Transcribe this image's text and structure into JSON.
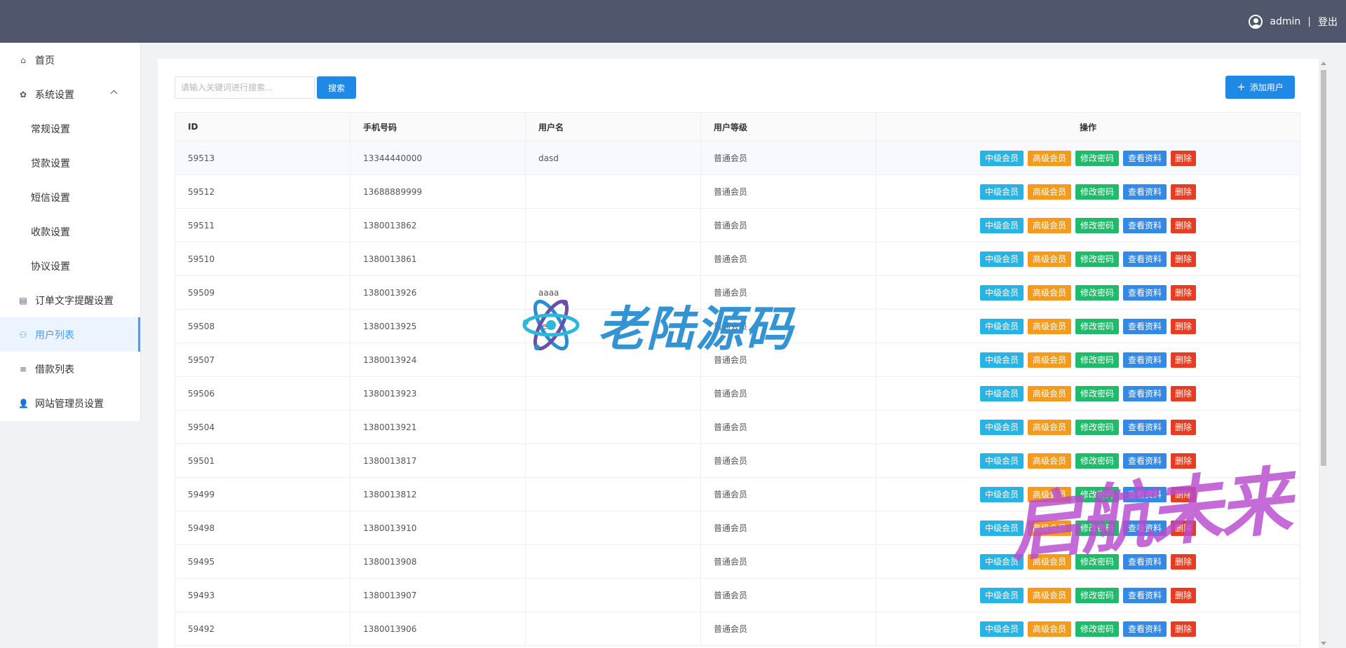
{
  "header": {
    "username": "admin",
    "separator": "|",
    "logout": "登出"
  },
  "sidebar": {
    "items": [
      {
        "label": "首页",
        "icon": "home-icon",
        "glyph": "⌂",
        "sub": false,
        "active": false,
        "expanded": false
      },
      {
        "label": "系统设置",
        "icon": "gear-icon",
        "glyph": "✿",
        "sub": false,
        "active": false,
        "expanded": true
      },
      {
        "label": "常规设置",
        "sub": true,
        "active": false
      },
      {
        "label": "贷款设置",
        "sub": true,
        "active": false
      },
      {
        "label": "短信设置",
        "sub": true,
        "active": false
      },
      {
        "label": "收款设置",
        "sub": true,
        "active": false
      },
      {
        "label": "协议设置",
        "sub": true,
        "active": false
      },
      {
        "label": "订单文字提醒设置",
        "icon": "document-icon",
        "glyph": "▤",
        "sub": false,
        "active": false
      },
      {
        "label": "用户列表",
        "icon": "users-icon",
        "glyph": "⚇",
        "sub": false,
        "active": true
      },
      {
        "label": "借款列表",
        "icon": "list-icon",
        "glyph": "≡",
        "sub": false,
        "active": false
      },
      {
        "label": "网站管理员设置",
        "icon": "user-icon",
        "glyph": "👤",
        "sub": false,
        "active": false
      }
    ]
  },
  "toolbar": {
    "search_placeholder": "请输入关键词进行搜索...",
    "search_label": "搜索",
    "add_label": "添加用户"
  },
  "table": {
    "columns": [
      "ID",
      "手机号码",
      "用户名",
      "用户等级",
      "操作"
    ],
    "actions": {
      "mid": "中级会员",
      "high": "高级会员",
      "pwd": "修改密码",
      "view": "查看资料",
      "del": "删除"
    },
    "rows": [
      {
        "id": "59513",
        "phone": "13344440000",
        "username": "dasd",
        "level": "普通会员"
      },
      {
        "id": "59512",
        "phone": "13688889999",
        "username": "",
        "level": "普通会员"
      },
      {
        "id": "59511",
        "phone": "1380013862",
        "username": "",
        "level": "普通会员"
      },
      {
        "id": "59510",
        "phone": "1380013861",
        "username": "",
        "level": "普通会员"
      },
      {
        "id": "59509",
        "phone": "1380013926",
        "username": "aaaa",
        "level": "普通会员"
      },
      {
        "id": "59508",
        "phone": "1380013925",
        "username": "test",
        "level": "普通会员"
      },
      {
        "id": "59507",
        "phone": "1380013924",
        "username": "",
        "level": "普通会员"
      },
      {
        "id": "59506",
        "phone": "1380013923",
        "username": "",
        "level": "普通会员"
      },
      {
        "id": "59504",
        "phone": "1380013921",
        "username": "",
        "level": "普通会员"
      },
      {
        "id": "59501",
        "phone": "1380013817",
        "username": "",
        "level": "普通会员"
      },
      {
        "id": "59499",
        "phone": "1380013812",
        "username": "",
        "level": "普通会员"
      },
      {
        "id": "59498",
        "phone": "1380013910",
        "username": "",
        "level": "普通会员"
      },
      {
        "id": "59495",
        "phone": "1380013908",
        "username": "",
        "level": "普通会员"
      },
      {
        "id": "59493",
        "phone": "1380013907",
        "username": "",
        "level": "普通会员"
      },
      {
        "id": "59492",
        "phone": "1380013906",
        "username": "",
        "level": "普通会员"
      }
    ]
  },
  "watermarks": {
    "center": "老陆源码",
    "corner": "启航未来"
  },
  "colors": {
    "header_bg": "#50576d",
    "primary": "#1f89e8",
    "mid_member": "#26b4e4",
    "high_member": "#f59a1b",
    "change_password": "#1fba6a",
    "view_profile": "#338ae6",
    "delete": "#e83b24"
  }
}
